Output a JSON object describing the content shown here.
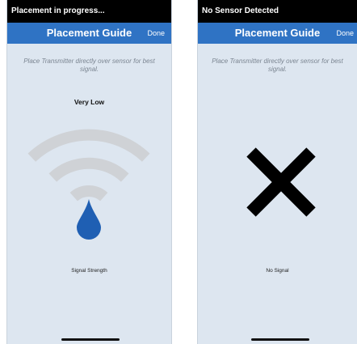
{
  "left_screen": {
    "status_text": "Placement in progress...",
    "nav_title": "Placement Guide",
    "done_label": "Done",
    "instruction": "Place Transmitter directly over sensor for best signal.",
    "signal_level": "Very Low",
    "caption": "Signal Strength",
    "icon": "wifi-signal-with-drop-icon"
  },
  "right_screen": {
    "status_text": "No Sensor Detected",
    "nav_title": "Placement Guide",
    "done_label": "Done",
    "instruction": "Place Transmitter directly over sensor for best signal.",
    "caption": "No Signal",
    "icon": "x-mark-icon"
  },
  "colors": {
    "nav_bar": "#2f73c4",
    "screen_bg": "#dde6f0",
    "signal_arc": "#cfd2d6",
    "drop": "#1f5fb3",
    "x_mark": "#000000"
  }
}
